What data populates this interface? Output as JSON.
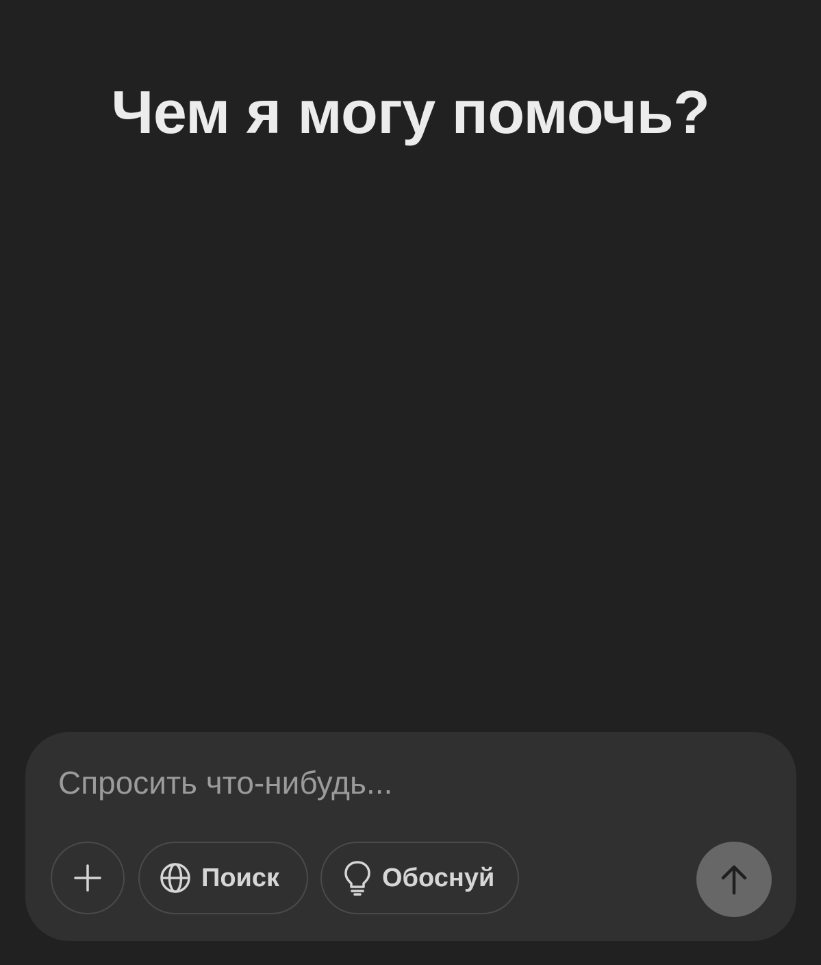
{
  "main": {
    "heading": "Чем я могу помочь?"
  },
  "composer": {
    "placeholder": "Спросить что-нибудь...",
    "actions": {
      "attach_icon": "plus-icon",
      "search_label": "Поиск",
      "search_icon": "globe-icon",
      "reason_label": "Обоснуй",
      "reason_icon": "lightbulb-icon",
      "send_icon": "arrow-up-icon"
    }
  },
  "colors": {
    "background": "#212121",
    "composer_bg": "#303030",
    "pill_border": "#4a4a4a",
    "send_button": "#676767",
    "text_primary": "#ececec",
    "text_placeholder": "#9b9b9b"
  }
}
